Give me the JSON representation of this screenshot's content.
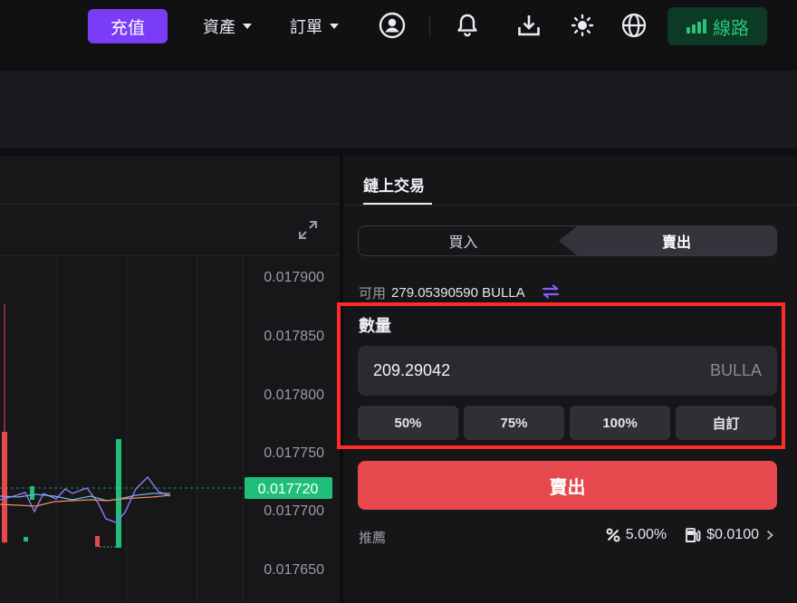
{
  "header": {
    "deposit_label": "充值",
    "assets_label": "資產",
    "orders_label": "訂單",
    "route_label": "線路",
    "icons": [
      "user-icon",
      "bell-icon",
      "download-icon",
      "theme-sun-icon",
      "globe-icon",
      "signal-icon"
    ]
  },
  "chart": {
    "price_ticks": [
      "0.017900",
      "0.017850",
      "0.017800",
      "0.017750",
      "0.017700",
      "0.017650"
    ],
    "current_price": "0.017720",
    "colors": {
      "up": "#1fbf7a",
      "down": "#e5484d",
      "ma1": "#8b7cf6",
      "ma2": "#e8905a",
      "ma3": "#6fb4e8"
    }
  },
  "trade": {
    "title": "鏈上交易",
    "tab_buy": "買入",
    "tab_sell": "賣出",
    "available_label": "可用",
    "available_value": "279.05390590 BULLA",
    "quantity_label": "數量",
    "quantity_value": "209.29042",
    "quantity_unit": "BULLA",
    "pct_buttons": [
      "50%",
      "75%",
      "100%",
      "自訂"
    ],
    "sell_button": "賣出",
    "recommend_label": "推薦",
    "slippage": "5.00%",
    "gas_fee": "$0.0100",
    "colors": {
      "accent": "#7a3cf5",
      "sell": "#e5484d",
      "route": "#28c27a"
    }
  }
}
